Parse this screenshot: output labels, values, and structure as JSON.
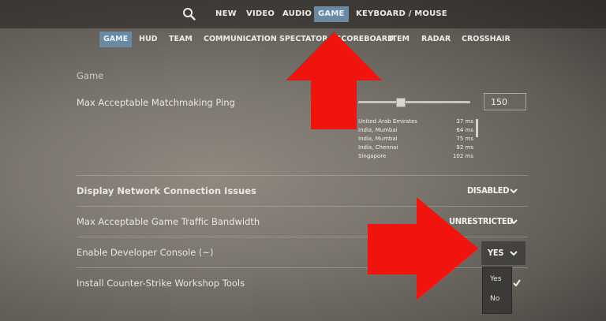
{
  "top_nav": {
    "items": [
      "NEW",
      "VIDEO",
      "AUDIO",
      "GAME",
      "KEYBOARD / MOUSE"
    ],
    "active": "GAME",
    "search_icon": "search-icon"
  },
  "sub_nav": {
    "items": [
      "GAME",
      "HUD",
      "TEAM",
      "COMMUNICATION",
      "SPECTATOR / SCOREBOARD",
      "ITEM",
      "RADAR",
      "CROSSHAIR"
    ],
    "active": "GAME"
  },
  "section_title": "Game",
  "matchmaking_ping": {
    "label": "Max Acceptable Matchmaking Ping",
    "value": "150",
    "slider_fraction": 0.38,
    "regions": [
      {
        "name": "United Arab Emirates",
        "ms": "37 ms"
      },
      {
        "name": "India, Mumbai",
        "ms": "64 ms"
      },
      {
        "name": "India, Mumbai",
        "ms": "75 ms"
      },
      {
        "name": "India, Chennai",
        "ms": "92 ms"
      },
      {
        "name": "Singapore",
        "ms": "102 ms"
      }
    ]
  },
  "network_issues": {
    "label": "Display Network Connection Issues",
    "value": "DISABLED"
  },
  "bandwidth": {
    "label": "Max Acceptable Game Traffic Bandwidth",
    "value": "UNRESTRICTED"
  },
  "dev_console": {
    "label": "Enable Developer Console (~)",
    "value": "YES",
    "options": [
      "Yes",
      "No"
    ]
  },
  "workshop_tools": {
    "label": "Install Counter-Strike Workshop Tools"
  },
  "colors": {
    "active_tab": "#6a8aa3",
    "annotation_arrow": "#f0130e"
  }
}
